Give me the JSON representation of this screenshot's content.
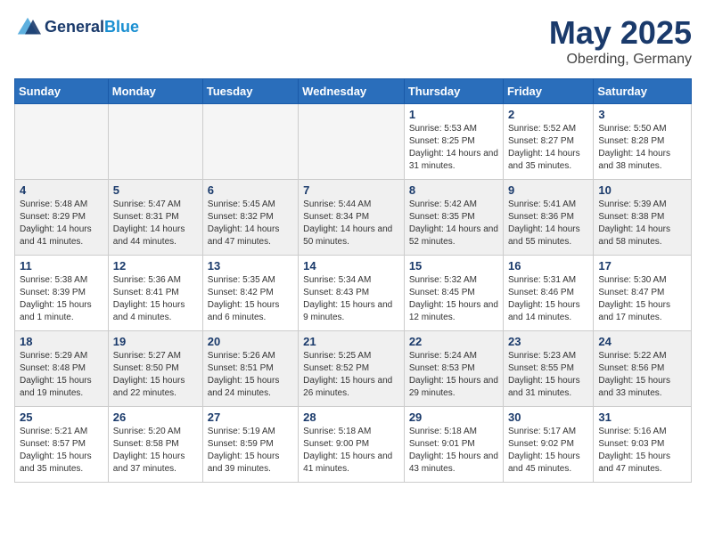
{
  "header": {
    "logo_text_general": "General",
    "logo_text_blue": "Blue",
    "month": "May 2025",
    "location": "Oberding, Germany"
  },
  "days_of_week": [
    "Sunday",
    "Monday",
    "Tuesday",
    "Wednesday",
    "Thursday",
    "Friday",
    "Saturday"
  ],
  "weeks": [
    [
      {
        "day": "",
        "empty": true
      },
      {
        "day": "",
        "empty": true
      },
      {
        "day": "",
        "empty": true
      },
      {
        "day": "",
        "empty": true
      },
      {
        "day": "1",
        "sunrise": "5:53 AM",
        "sunset": "8:25 PM",
        "daylight": "14 hours and 31 minutes."
      },
      {
        "day": "2",
        "sunrise": "5:52 AM",
        "sunset": "8:27 PM",
        "daylight": "14 hours and 35 minutes."
      },
      {
        "day": "3",
        "sunrise": "5:50 AM",
        "sunset": "8:28 PM",
        "daylight": "14 hours and 38 minutes."
      }
    ],
    [
      {
        "day": "4",
        "sunrise": "5:48 AM",
        "sunset": "8:29 PM",
        "daylight": "14 hours and 41 minutes."
      },
      {
        "day": "5",
        "sunrise": "5:47 AM",
        "sunset": "8:31 PM",
        "daylight": "14 hours and 44 minutes."
      },
      {
        "day": "6",
        "sunrise": "5:45 AM",
        "sunset": "8:32 PM",
        "daylight": "14 hours and 47 minutes."
      },
      {
        "day": "7",
        "sunrise": "5:44 AM",
        "sunset": "8:34 PM",
        "daylight": "14 hours and 50 minutes."
      },
      {
        "day": "8",
        "sunrise": "5:42 AM",
        "sunset": "8:35 PM",
        "daylight": "14 hours and 52 minutes."
      },
      {
        "day": "9",
        "sunrise": "5:41 AM",
        "sunset": "8:36 PM",
        "daylight": "14 hours and 55 minutes."
      },
      {
        "day": "10",
        "sunrise": "5:39 AM",
        "sunset": "8:38 PM",
        "daylight": "14 hours and 58 minutes."
      }
    ],
    [
      {
        "day": "11",
        "sunrise": "5:38 AM",
        "sunset": "8:39 PM",
        "daylight": "15 hours and 1 minute."
      },
      {
        "day": "12",
        "sunrise": "5:36 AM",
        "sunset": "8:41 PM",
        "daylight": "15 hours and 4 minutes."
      },
      {
        "day": "13",
        "sunrise": "5:35 AM",
        "sunset": "8:42 PM",
        "daylight": "15 hours and 6 minutes."
      },
      {
        "day": "14",
        "sunrise": "5:34 AM",
        "sunset": "8:43 PM",
        "daylight": "15 hours and 9 minutes."
      },
      {
        "day": "15",
        "sunrise": "5:32 AM",
        "sunset": "8:45 PM",
        "daylight": "15 hours and 12 minutes."
      },
      {
        "day": "16",
        "sunrise": "5:31 AM",
        "sunset": "8:46 PM",
        "daylight": "15 hours and 14 minutes."
      },
      {
        "day": "17",
        "sunrise": "5:30 AM",
        "sunset": "8:47 PM",
        "daylight": "15 hours and 17 minutes."
      }
    ],
    [
      {
        "day": "18",
        "sunrise": "5:29 AM",
        "sunset": "8:48 PM",
        "daylight": "15 hours and 19 minutes."
      },
      {
        "day": "19",
        "sunrise": "5:27 AM",
        "sunset": "8:50 PM",
        "daylight": "15 hours and 22 minutes."
      },
      {
        "day": "20",
        "sunrise": "5:26 AM",
        "sunset": "8:51 PM",
        "daylight": "15 hours and 24 minutes."
      },
      {
        "day": "21",
        "sunrise": "5:25 AM",
        "sunset": "8:52 PM",
        "daylight": "15 hours and 26 minutes."
      },
      {
        "day": "22",
        "sunrise": "5:24 AM",
        "sunset": "8:53 PM",
        "daylight": "15 hours and 29 minutes."
      },
      {
        "day": "23",
        "sunrise": "5:23 AM",
        "sunset": "8:55 PM",
        "daylight": "15 hours and 31 minutes."
      },
      {
        "day": "24",
        "sunrise": "5:22 AM",
        "sunset": "8:56 PM",
        "daylight": "15 hours and 33 minutes."
      }
    ],
    [
      {
        "day": "25",
        "sunrise": "5:21 AM",
        "sunset": "8:57 PM",
        "daylight": "15 hours and 35 minutes."
      },
      {
        "day": "26",
        "sunrise": "5:20 AM",
        "sunset": "8:58 PM",
        "daylight": "15 hours and 37 minutes."
      },
      {
        "day": "27",
        "sunrise": "5:19 AM",
        "sunset": "8:59 PM",
        "daylight": "15 hours and 39 minutes."
      },
      {
        "day": "28",
        "sunrise": "5:18 AM",
        "sunset": "9:00 PM",
        "daylight": "15 hours and 41 minutes."
      },
      {
        "day": "29",
        "sunrise": "5:18 AM",
        "sunset": "9:01 PM",
        "daylight": "15 hours and 43 minutes."
      },
      {
        "day": "30",
        "sunrise": "5:17 AM",
        "sunset": "9:02 PM",
        "daylight": "15 hours and 45 minutes."
      },
      {
        "day": "31",
        "sunrise": "5:16 AM",
        "sunset": "9:03 PM",
        "daylight": "15 hours and 47 minutes."
      }
    ]
  ]
}
